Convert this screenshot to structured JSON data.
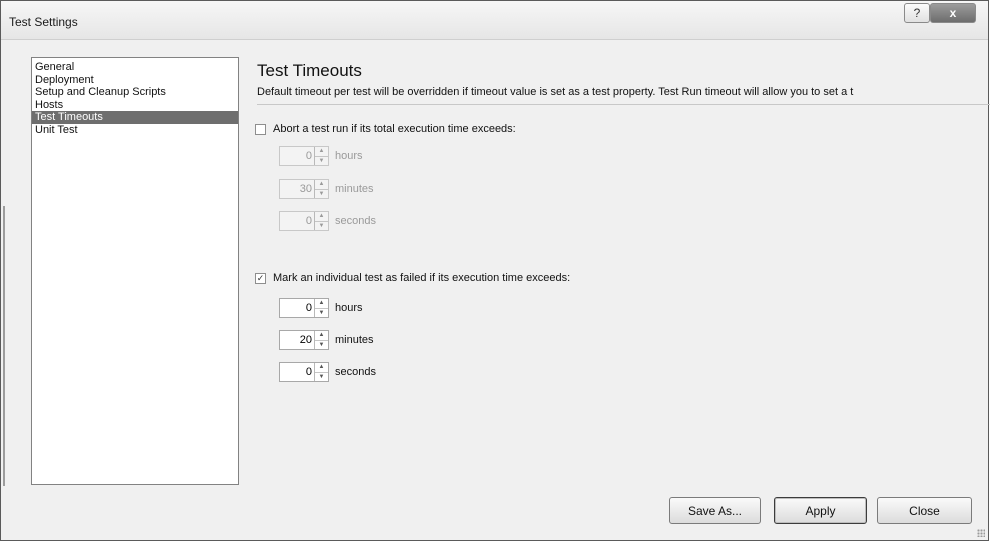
{
  "window": {
    "title": "Test Settings",
    "help_label": "?",
    "close_label": "x"
  },
  "nav": {
    "items": [
      {
        "label": "General"
      },
      {
        "label": "Deployment"
      },
      {
        "label": "Setup and Cleanup Scripts"
      },
      {
        "label": "Hosts"
      },
      {
        "label": "Test Timeouts",
        "selected": true
      },
      {
        "label": "Unit Test"
      }
    ]
  },
  "content": {
    "heading": "Test Timeouts",
    "description": "Default timeout per test will be overridden if timeout value is set as a test property. Test Run timeout will allow you to set a t",
    "abort": {
      "label": "Abort a test run if its total execution time exceeds:",
      "checked": false,
      "hours": "0",
      "minutes": "30",
      "seconds": "0"
    },
    "mark": {
      "label": "Mark an individual test as failed if its execution time exceeds:",
      "checked": true,
      "hours": "0",
      "minutes": "20",
      "seconds": "0"
    },
    "units": {
      "hours": "hours",
      "minutes": "minutes",
      "seconds": "seconds"
    },
    "check_glyph": "✓",
    "arrow_up": "▲",
    "arrow_down": "▼"
  },
  "buttons": {
    "save_as": "Save As...",
    "apply": "Apply",
    "close": "Close"
  }
}
